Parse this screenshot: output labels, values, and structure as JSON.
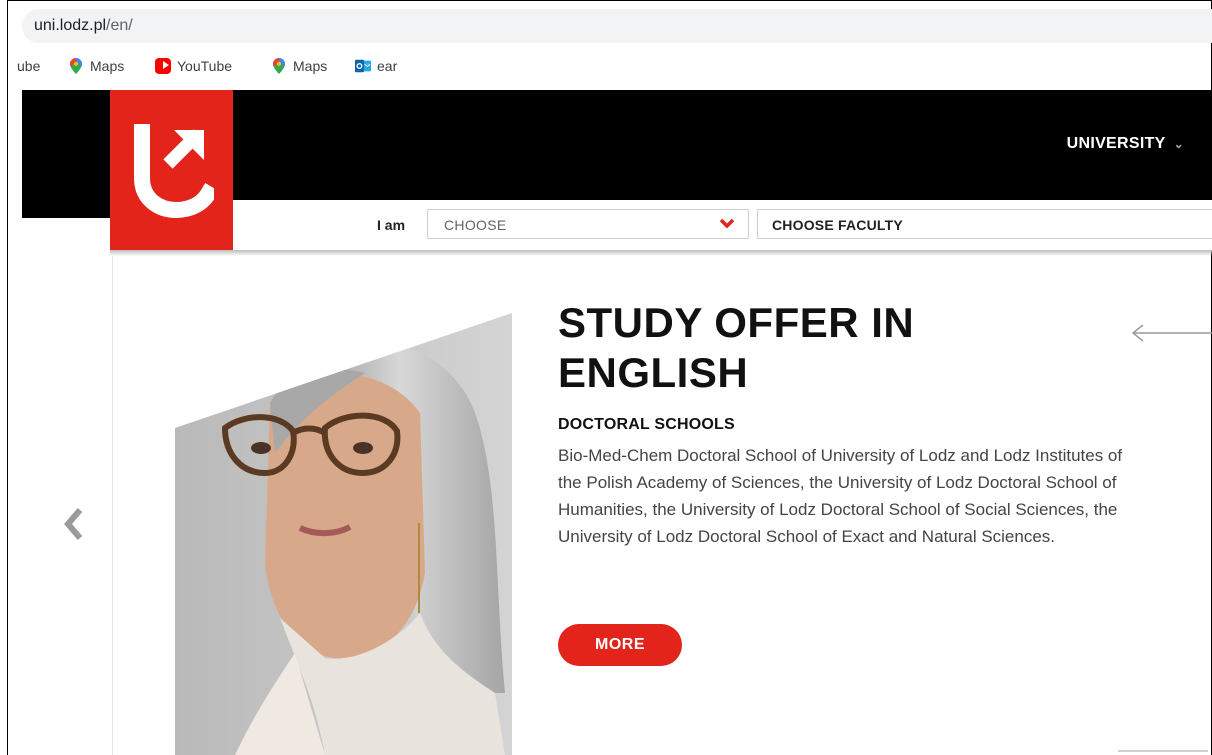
{
  "browser": {
    "address": {
      "host": "uni.lodz.pl",
      "path": "/en/"
    },
    "bookmarks": [
      {
        "label": "ube",
        "icon": "bookmark-fragment"
      },
      {
        "label": "Maps",
        "icon": "maps-pin-icon"
      },
      {
        "label": "YouTube",
        "icon": "youtube-icon"
      },
      {
        "label": "Maps",
        "icon": "maps-pin-icon"
      },
      {
        "label": "ear",
        "icon": "outlook-icon"
      }
    ]
  },
  "header": {
    "nav_university": "UNIVERSITY",
    "brand_color": "#e3241b"
  },
  "selector": {
    "iam_label": "I am",
    "role_placeholder": "CHOOSE",
    "faculty_placeholder": "CHOOSE FACULTY"
  },
  "hero": {
    "title": "STUDY OFFER IN ENGLISH",
    "subtitle": "DOCTORAL SCHOOLS",
    "description": "Bio-Med-Chem Doctoral School of University of Lodz and Lodz Institutes of the Polish Academy of Sciences, the University of Lodz Doctoral School of Humanities, the University of Lodz Doctoral School of Social Sciences, the University of Lodz Doctoral School of Exact and Natural Sciences.",
    "more_label": "MORE"
  }
}
